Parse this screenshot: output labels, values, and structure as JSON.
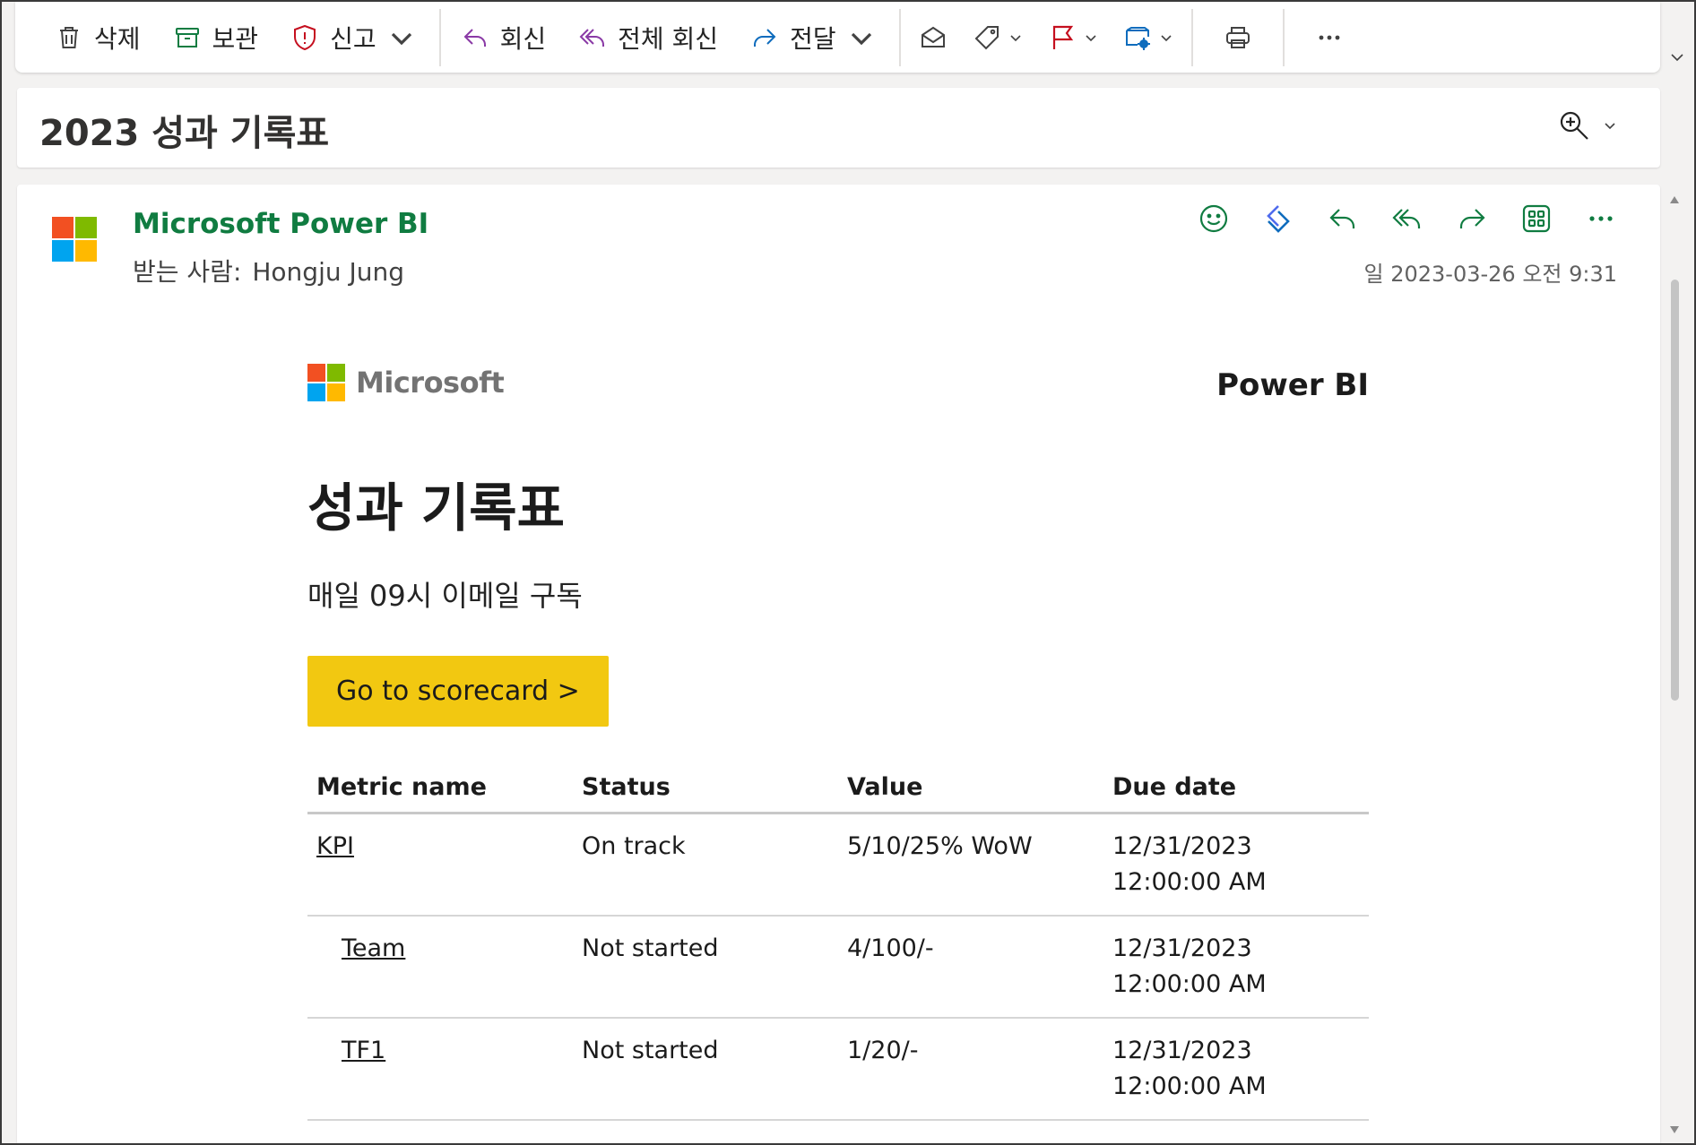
{
  "colors": {
    "accent_green": "#107c41",
    "cta_yellow": "#f2c811",
    "reply_purple": "#8a3aa6",
    "forward_blue": "#0f6cbd",
    "flag_red": "#c50f1f"
  },
  "toolbar": {
    "delete_label": "삭제",
    "archive_label": "보관",
    "report_label": "신고",
    "reply_label": "회신",
    "reply_all_label": "전체 회신",
    "forward_label": "전달",
    "icons": [
      "trash-icon",
      "archive-icon",
      "shield-warning-icon",
      "reply-icon",
      "reply-all-icon",
      "forward-icon",
      "mark-read-icon",
      "tag-icon",
      "flag-icon",
      "rules-icon",
      "print-icon",
      "more-icon"
    ]
  },
  "subject": {
    "title": "2023 성과 기록표"
  },
  "message": {
    "sender_name": "Microsoft Power BI",
    "to_label": "받는 사람:",
    "recipient": "Hongju Jung",
    "timestamp": "일 2023-03-26 오전 9:31",
    "action_icons": [
      "emoji-icon",
      "loop-icon",
      "reply-icon",
      "reply-all-icon",
      "forward-icon",
      "apps-icon",
      "more-icon"
    ]
  },
  "email": {
    "brand_left": "Microsoft",
    "brand_right": "Power BI",
    "title": "성과 기록표",
    "subtitle": "매일 09시 이메일 구독",
    "cta_label": "Go to scorecard >",
    "table": {
      "headers": [
        "Metric name",
        "Status",
        "Value",
        "Due date"
      ],
      "rows": [
        {
          "name": "KPI",
          "status": "On track",
          "value": "5/10/25% WoW",
          "due": "12/31/2023 12:00:00 AM"
        },
        {
          "name": "Team",
          "status": "Not started",
          "value": "4/100/-",
          "due": "12/31/2023 12:00:00 AM"
        },
        {
          "name": "TF1",
          "status": "Not started",
          "value": "1/20/-",
          "due": "12/31/2023 12:00:00 AM"
        }
      ]
    }
  }
}
